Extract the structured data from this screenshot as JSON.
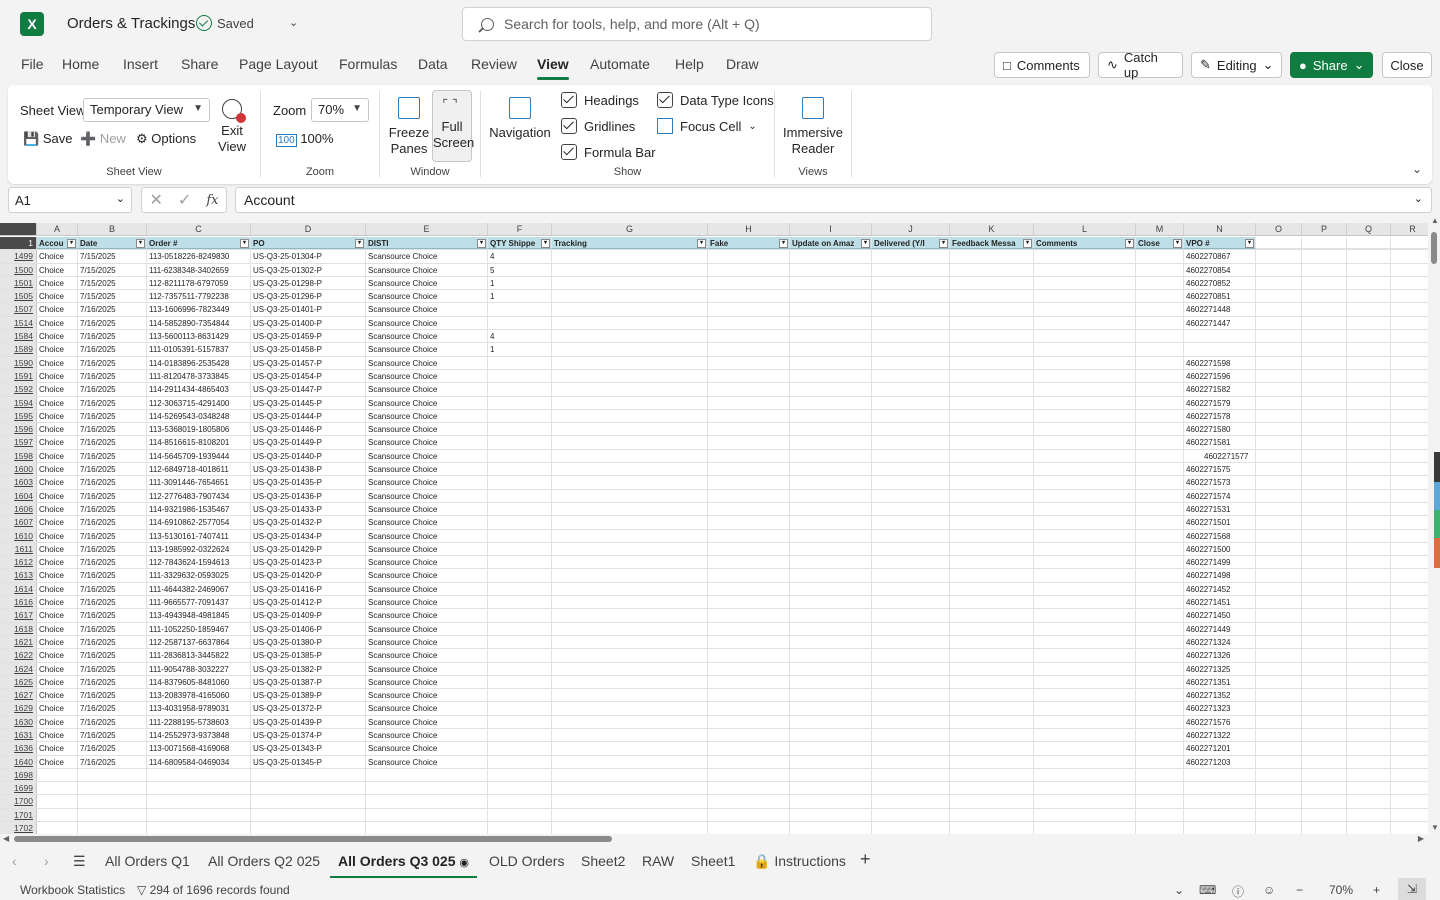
{
  "app": {
    "title": "Orders & Trackings",
    "saved_status": "Saved",
    "search_placeholder": "Search for tools, help, and more (Alt + Q)"
  },
  "menu": {
    "tabs": [
      "File",
      "Home",
      "Insert",
      "Share",
      "Page Layout",
      "Formulas",
      "Data",
      "Review",
      "View",
      "Automate",
      "Help",
      "Draw"
    ],
    "active": "View",
    "buttons": {
      "comments": "Comments",
      "catch_up": "Catch up",
      "editing": "Editing",
      "share": "Share",
      "close": "Close"
    }
  },
  "ribbon": {
    "sheet_view": {
      "label": "Sheet View",
      "field_label": "Sheet View",
      "selected": "Temporary View",
      "save": "Save",
      "new": "New",
      "options": "Options",
      "exit_view": "Exit View"
    },
    "zoom": {
      "label": "Zoom",
      "field_label": "Zoom",
      "value": "70%",
      "hundred": "100%"
    },
    "window": {
      "label": "Window",
      "freeze": "Freeze Panes",
      "full_screen": "Full Screen"
    },
    "show": {
      "label": "Show",
      "navigation": "Navigation",
      "headings": "Headings",
      "gridlines": "Gridlines",
      "formula_bar": "Formula Bar",
      "data_type_icons": "Data Type Icons",
      "focus_cell": "Focus Cell"
    },
    "views": {
      "label": "Views",
      "immersive_reader": "Immersive Reader"
    }
  },
  "formula_bar": {
    "cell_ref": "A1",
    "value": "Account"
  },
  "sheet": {
    "columns": [
      "A",
      "B",
      "C",
      "D",
      "E",
      "F",
      "G",
      "H",
      "I",
      "J",
      "K",
      "L",
      "M",
      "N",
      "O",
      "P",
      "Q",
      "R"
    ],
    "header_row_num": "1",
    "headers": [
      "Accou",
      "Date",
      "Order #",
      "PO",
      "DISTI",
      "QTY Shippe",
      "Tracking",
      "Fake",
      "Update on Amaz",
      "Delivered (Y/I",
      "Feedback Messa",
      "Comments",
      "Close",
      "VPO #",
      "",
      "",
      "",
      ""
    ],
    "rows": [
      [
        "1499",
        "Choice",
        "7/15/2025",
        "113-0518226-8249830",
        "US-Q3-25-01304-P",
        "Scansource Choice",
        "4",
        "4602270867"
      ],
      [
        "1500",
        "Choice",
        "7/15/2025",
        "111-6238348-3402659",
        "US-Q3-25-01302-P",
        "Scansource Choice",
        "5",
        "4602270854"
      ],
      [
        "1501",
        "Choice",
        "7/15/2025",
        "112-8211178-6797059",
        "US-Q3-25-01298-P",
        "Scansource Choice",
        "1",
        "4602270852"
      ],
      [
        "1505",
        "Choice",
        "7/15/2025",
        "112-7357511-7792238",
        "US-Q3-25-01296-P",
        "Scansource Choice",
        "1",
        "4602270851"
      ],
      [
        "1507",
        "Choice",
        "7/16/2025",
        "113-1606996-7823449",
        "US-Q3-25-01401-P",
        "Scansource Choice",
        "",
        "4602271448"
      ],
      [
        "1514",
        "Choice",
        "7/16/2025",
        "114-5852890-7354844",
        "US-Q3-25-01400-P",
        "Scansource Choice",
        "",
        "4602271447"
      ],
      [
        "1584",
        "Choice",
        "7/16/2025",
        "113-5600113-8631429",
        "US-Q3-25-01459-P",
        "Scansource Choice",
        "4",
        ""
      ],
      [
        "1589",
        "Choice",
        "7/16/2025",
        "111-0105391-5157837",
        "US-Q3-25-01458-P",
        "Scansource Choice",
        "1",
        ""
      ],
      [
        "1590",
        "Choice",
        "7/16/2025",
        "114-0183896-2535428",
        "US-Q3-25-01457-P",
        "Scansource Choice",
        "",
        "4602271598"
      ],
      [
        "1591",
        "Choice",
        "7/16/2025",
        "111-8120478-3733845",
        "US-Q3-25-01454-P",
        "Scansource Choice",
        "",
        "4602271596"
      ],
      [
        "1592",
        "Choice",
        "7/16/2025",
        "114-2911434-4865403",
        "US-Q3-25-01447-P",
        "Scansource Choice",
        "",
        "4602271582"
      ],
      [
        "1594",
        "Choice",
        "7/16/2025",
        "112-3063715-4291400",
        "US-Q3-25-01445-P",
        "Scansource Choice",
        "",
        "4602271579"
      ],
      [
        "1595",
        "Choice",
        "7/16/2025",
        "114-5269543-0348248",
        "US-Q3-25-01444-P",
        "Scansource Choice",
        "",
        "4602271578"
      ],
      [
        "1596",
        "Choice",
        "7/16/2025",
        "113-5368019-1805806",
        "US-Q3-25-01446-P",
        "Scansource Choice",
        "",
        "4602271580"
      ],
      [
        "1597",
        "Choice",
        "7/16/2025",
        "114-8516615-8108201",
        "US-Q3-25-01449-P",
        "Scansource Choice",
        "",
        "4602271581"
      ],
      [
        "1598",
        "Choice",
        "7/16/2025",
        "114-5645709-1939444",
        "US-Q3-25-01440-P",
        "Scansource Choice",
        "",
        "4602271577"
      ],
      [
        "1600",
        "Choice",
        "7/16/2025",
        "112-6849718-4018611",
        "US-Q3-25-01438-P",
        "Scansource Choice",
        "",
        "4602271575"
      ],
      [
        "1603",
        "Choice",
        "7/16/2025",
        "111-3091446-7654651",
        "US-Q3-25-01435-P",
        "Scansource Choice",
        "",
        "4602271573"
      ],
      [
        "1604",
        "Choice",
        "7/16/2025",
        "112-2776483-7907434",
        "US-Q3-25-01436-P",
        "Scansource Choice",
        "",
        "4602271574"
      ],
      [
        "1606",
        "Choice",
        "7/16/2025",
        "114-9321986-1535467",
        "US-Q3-25-01433-P",
        "Scansource Choice",
        "",
        "4602271531"
      ],
      [
        "1607",
        "Choice",
        "7/16/2025",
        "114-6910862-2577054",
        "US-Q3-25-01432-P",
        "Scansource Choice",
        "",
        "4602271501"
      ],
      [
        "1610",
        "Choice",
        "7/16/2025",
        "113-5130161-7407411",
        "US-Q3-25-01434-P",
        "Scansource Choice",
        "",
        "4602271568"
      ],
      [
        "1611",
        "Choice",
        "7/16/2025",
        "113-1985992-0322624",
        "US-Q3-25-01429-P",
        "Scansource Choice",
        "",
        "4602271500"
      ],
      [
        "1612",
        "Choice",
        "7/16/2025",
        "112-7843624-1594613",
        "US-Q3-25-01423-P",
        "Scansource Choice",
        "",
        "4602271499"
      ],
      [
        "1613",
        "Choice",
        "7/16/2025",
        "111-3329632-0593025",
        "US-Q3-25-01420-P",
        "Scansource Choice",
        "",
        "4602271498"
      ],
      [
        "1614",
        "Choice",
        "7/16/2025",
        "111-4644382-2469067",
        "US-Q3-25-01416-P",
        "Scansource Choice",
        "",
        "4602271452"
      ],
      [
        "1616",
        "Choice",
        "7/16/2025",
        "111-9665577-7091437",
        "US-Q3-25-01412-P",
        "Scansource Choice",
        "",
        "4602271451"
      ],
      [
        "1617",
        "Choice",
        "7/16/2025",
        "113-4943948-4981845",
        "US-Q3-25-01409-P",
        "Scansource Choice",
        "",
        "4602271450"
      ],
      [
        "1618",
        "Choice",
        "7/16/2025",
        "111-1052250-1859467",
        "US-Q3-25-01406-P",
        "Scansource Choice",
        "",
        "4602271449"
      ],
      [
        "1621",
        "Choice",
        "7/16/2025",
        "112-2587137-6637864",
        "US-Q3-25-01380-P",
        "Scansource Choice",
        "",
        "4602271324"
      ],
      [
        "1622",
        "Choice",
        "7/16/2025",
        "111-2836813-3445822",
        "US-Q3-25-01385-P",
        "Scansource Choice",
        "",
        "4602271326"
      ],
      [
        "1624",
        "Choice",
        "7/16/2025",
        "111-9054788-3032227",
        "US-Q3-25-01382-P",
        "Scansource Choice",
        "",
        "4602271325"
      ],
      [
        "1625",
        "Choice",
        "7/16/2025",
        "114-8379605-8481060",
        "US-Q3-25-01387-P",
        "Scansource Choice",
        "",
        "4602271351"
      ],
      [
        "1627",
        "Choice",
        "7/16/2025",
        "113-2083978-4165060",
        "US-Q3-25-01389-P",
        "Scansource Choice",
        "",
        "4602271352"
      ],
      [
        "1629",
        "Choice",
        "7/16/2025",
        "113-4031958-9789031",
        "US-Q3-25-01372-P",
        "Scansource Choice",
        "",
        "4602271323"
      ],
      [
        "1630",
        "Choice",
        "7/16/2025",
        "111-2288195-5738603",
        "US-Q3-25-01439-P",
        "Scansource Choice",
        "",
        "4602271576"
      ],
      [
        "1631",
        "Choice",
        "7/16/2025",
        "114-2552973-9373848",
        "US-Q3-25-01374-P",
        "Scansource Choice",
        "",
        "4602271322"
      ],
      [
        "1636",
        "Choice",
        "7/16/2025",
        "113-0071568-4169068",
        "US-Q3-25-01343-P",
        "Scansource Choice",
        "",
        "4602271201"
      ],
      [
        "1640",
        "Choice",
        "7/16/2025",
        "114-6809584-0469034",
        "US-Q3-25-01345-P",
        "Scansource Choice",
        "",
        "4602271203"
      ],
      [
        "1698",
        "",
        "",
        "",
        "",
        "",
        "",
        ""
      ],
      [
        "1699",
        "",
        "",
        "",
        "",
        "",
        "",
        ""
      ],
      [
        "1700",
        "",
        "",
        "",
        "",
        "",
        "",
        ""
      ],
      [
        "1701",
        "",
        "",
        "",
        "",
        "",
        "",
        ""
      ],
      [
        "1702",
        "",
        "",
        "",
        "",
        "",
        "",
        ""
      ]
    ]
  },
  "sheet_tabs": [
    "All Orders Q1",
    "All Orders Q2 025",
    "All Orders Q3 025",
    "OLD Orders",
    "Sheet2",
    "RAW",
    "Sheet1",
    "Instructions"
  ],
  "active_sheet": "All Orders Q3 025",
  "status": {
    "workbook_stats": "Workbook Statistics",
    "records": "294 of 1696 records found",
    "zoom": "70%"
  },
  "colors": {
    "accent": "#107c41",
    "header_fill": "#bfdfe8"
  }
}
